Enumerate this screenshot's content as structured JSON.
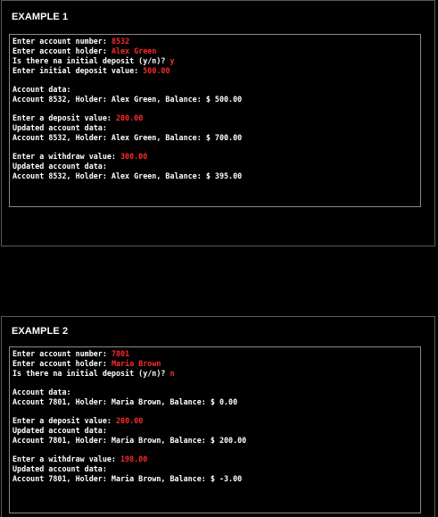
{
  "colors": {
    "background": "#000000",
    "text": "#ffffff",
    "user_input": "#ff2a2a"
  },
  "examples": [
    {
      "title": "EXAMPLE 1",
      "lines": [
        {
          "prompt": "Enter account number: ",
          "input": "8532"
        },
        {
          "prompt": "Enter account holder: ",
          "input": "Alex Green"
        },
        {
          "prompt": "Is there na initial deposit (y/n)? ",
          "input": "y"
        },
        {
          "prompt": "Enter initial deposit value: ",
          "input": "500.00"
        },
        {
          "gap": true
        },
        {
          "prompt": "Account data:",
          "input": ""
        },
        {
          "prompt": "Account 8532, Holder: Alex Green, Balance: $ 500.00",
          "input": ""
        },
        {
          "gap": true
        },
        {
          "prompt": "Enter a deposit value: ",
          "input": "200.00"
        },
        {
          "prompt": "Updated account data:",
          "input": ""
        },
        {
          "prompt": "Account 8532, Holder: Alex Green, Balance: $ 700.00",
          "input": ""
        },
        {
          "gap": true
        },
        {
          "prompt": "Enter a withdraw value: ",
          "input": "300.00"
        },
        {
          "prompt": "Updated account data:",
          "input": ""
        },
        {
          "prompt": "Account 8532, Holder: Alex Green, Balance: $ 395.00",
          "input": ""
        }
      ]
    },
    {
      "title": "EXAMPLE 2",
      "lines": [
        {
          "prompt": "Enter account number: ",
          "input": "7801"
        },
        {
          "prompt": "Enter account holder: ",
          "input": "Maria Brown"
        },
        {
          "prompt": "Is there na initial deposit (y/n)? ",
          "input": "n"
        },
        {
          "gap": true
        },
        {
          "prompt": "Account data:",
          "input": ""
        },
        {
          "prompt": "Account 7801, Holder: Maria Brown, Balance: $ 0.00",
          "input": ""
        },
        {
          "gap": true
        },
        {
          "prompt": "Enter a deposit value: ",
          "input": "200.00"
        },
        {
          "prompt": "Updated account data:",
          "input": ""
        },
        {
          "prompt": "Account 7801, Holder: Maria Brown, Balance: $ 200.00",
          "input": ""
        },
        {
          "gap": true
        },
        {
          "prompt": "Enter a withdraw value: ",
          "input": "198.00"
        },
        {
          "prompt": "Updated account data:",
          "input": ""
        },
        {
          "prompt": "Account 7801, Holder: Maria Brown, Balance: $ -3.00",
          "input": ""
        }
      ]
    }
  ]
}
